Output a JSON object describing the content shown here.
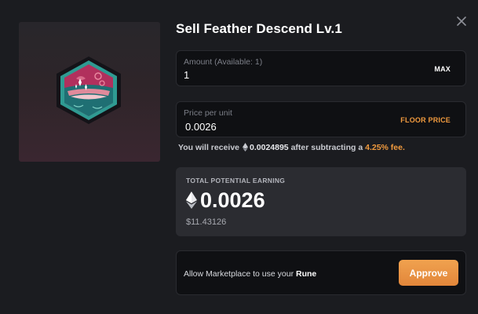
{
  "dialog": {
    "title": "Sell Feather Descend Lv.1",
    "close_icon": "close-icon",
    "item_image": "feather-descend-badge"
  },
  "amount": {
    "label": "Amount (Available: 1)",
    "value": "1",
    "max_label": "MAX"
  },
  "price": {
    "label": "Price per unit",
    "value": "0.0026",
    "floor_label": "FLOOR PRICE"
  },
  "receive": {
    "prefix": "You will receive",
    "amount": "0.0024895",
    "middle": "after subtracting a",
    "fee": "4.25% fee."
  },
  "earning": {
    "caption": "TOTAL POTENTIAL EARNING",
    "value": "0.0026",
    "usd": "$11.43126"
  },
  "approve": {
    "text": "Allow Marketplace to use your",
    "token": "Rune",
    "button_label": "Approve"
  },
  "colors": {
    "accent": "#f09a3e",
    "background": "#1b1c20",
    "field": "#0f1013",
    "panel": "#2b2c31"
  }
}
